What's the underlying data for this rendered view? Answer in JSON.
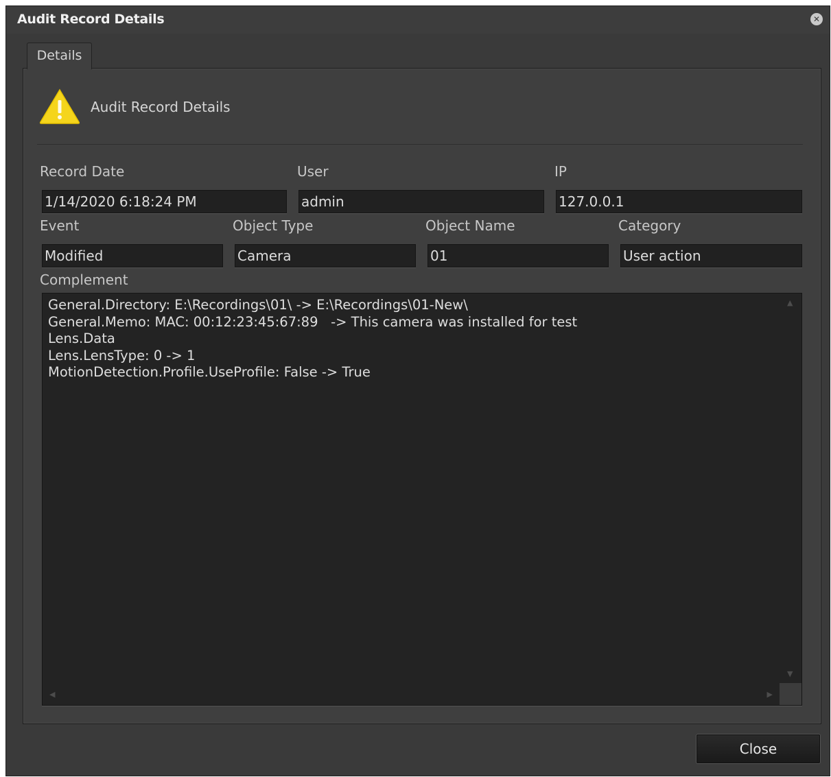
{
  "window": {
    "title": "Audit Record Details",
    "close_icon": "close-circle-icon"
  },
  "tabs": [
    {
      "label": "Details",
      "selected": true
    }
  ],
  "header": {
    "icon": "warning-triangle-icon",
    "title": "Audit Record Details"
  },
  "fields": {
    "record_date": {
      "label": "Record Date",
      "value": "1/14/2020 6:18:24 PM"
    },
    "user": {
      "label": "User",
      "value": "admin"
    },
    "ip": {
      "label": "IP",
      "value": "127.0.0.1"
    },
    "event": {
      "label": "Event",
      "value": "Modified"
    },
    "object_type": {
      "label": "Object Type",
      "value": "Camera"
    },
    "object_name": {
      "label": "Object Name",
      "value": "01"
    },
    "category": {
      "label": "Category",
      "value": "User action"
    }
  },
  "complement": {
    "label": "Complement",
    "lines": [
      "General.Directory: E:\\Recordings\\01\\ -> E:\\Recordings\\01-New\\",
      "General.Memo: MAC: 00:12:23:45:67:89   -> This camera was installed for test",
      "Lens.Data",
      "Lens.LensType: 0 -> 1",
      "MotionDetection.Profile.UseProfile: False -> True"
    ]
  },
  "footer": {
    "close_label": "Close"
  },
  "colors": {
    "background": "#3a3a3a",
    "field_background": "#212121",
    "text": "#d0d0d0",
    "warning": "#f5d51c"
  }
}
